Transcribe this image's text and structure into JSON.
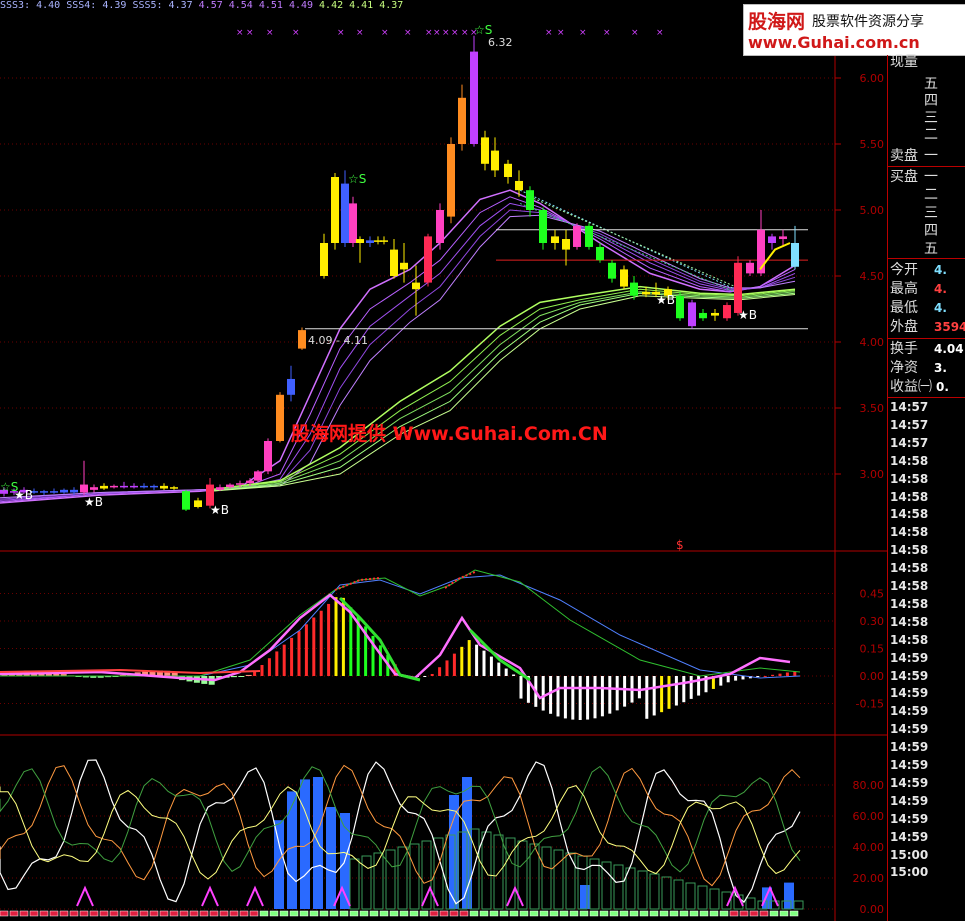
{
  "topbar": {
    "items": [
      {
        "text": "SSS3: 4.40",
        "color": "#aab4ff"
      },
      {
        "text": "SSS4: 4.39",
        "color": "#aab4ff"
      },
      {
        "text": "SSS5: 4.37",
        "color": "#aab4ff"
      },
      {
        "text": "4.57",
        "color": "#c07cff"
      },
      {
        "text": "4.54",
        "color": "#c07cff"
      },
      {
        "text": "4.51",
        "color": "#c07cff"
      },
      {
        "text": "4.49",
        "color": "#c07cff"
      },
      {
        "text": "4.42",
        "color": "#c8ff80"
      },
      {
        "text": "4.41",
        "color": "#c8ff80"
      },
      {
        "text": "4.37",
        "color": "#c8ff80"
      }
    ]
  },
  "logo": {
    "brand": "股海网",
    "slogan": "股票软件资源分享",
    "url": "www.Guhai.com.cn"
  },
  "watermark": "股海网提供 Www.Guhai.Com.CN",
  "price_axis": [
    "6.00",
    "5.50",
    "5.00",
    "4.50",
    "4.00",
    "3.50",
    "3.00"
  ],
  "macd_axis": [
    "0.45",
    "0.30",
    "0.15",
    "0.00",
    "-0.15"
  ],
  "kdj_axis": [
    "80.00",
    "60.00",
    "40.00",
    "20.00",
    "0.00"
  ],
  "annotations": {
    "high_label": "6.32",
    "range_label": "4.09 - 4.11",
    "signal_s": "☆S",
    "signal_b": "★B",
    "dollar": "$"
  },
  "sidepanel": {
    "xianliang": "现量",
    "sell_levels": [
      "五",
      "四",
      "三",
      "二",
      "一"
    ],
    "maipan": "卖盘",
    "buypan": "买盘",
    "buy_levels": [
      "一",
      "二",
      "三",
      "四",
      "五"
    ],
    "stats": [
      {
        "label": "今开",
        "value": "4.",
        "color": "#7fdfff"
      },
      {
        "label": "最高",
        "value": "4.",
        "color": "#ff4040"
      },
      {
        "label": "最低",
        "value": "4.",
        "color": "#7fdfff"
      },
      {
        "label": "外盘",
        "value": "3594",
        "color": "#ff4040"
      }
    ],
    "stats2": [
      {
        "label": "换手",
        "value": "4.04",
        "color": "#ffffff"
      },
      {
        "label": "净资",
        "value": "3.",
        "color": "#ffffff"
      },
      {
        "label": "收益㈠",
        "value": "0.",
        "color": "#ffffff"
      }
    ],
    "times": [
      "14:57",
      "14:57",
      "14:57",
      "14:58",
      "14:58",
      "14:58",
      "14:58",
      "14:58",
      "14:58",
      "14:58",
      "14:58",
      "14:58",
      "14:58",
      "14:58",
      "14:59",
      "14:59",
      "14:59",
      "14:59",
      "14:59",
      "14:59",
      "14:59",
      "14:59",
      "14:59",
      "14:59",
      "14:59",
      "15:00",
      "15:00"
    ]
  },
  "colors": {
    "up": "#ff2a2a",
    "down": "#1eff1e",
    "axis": "#b00000",
    "bg": "#000000"
  }
}
